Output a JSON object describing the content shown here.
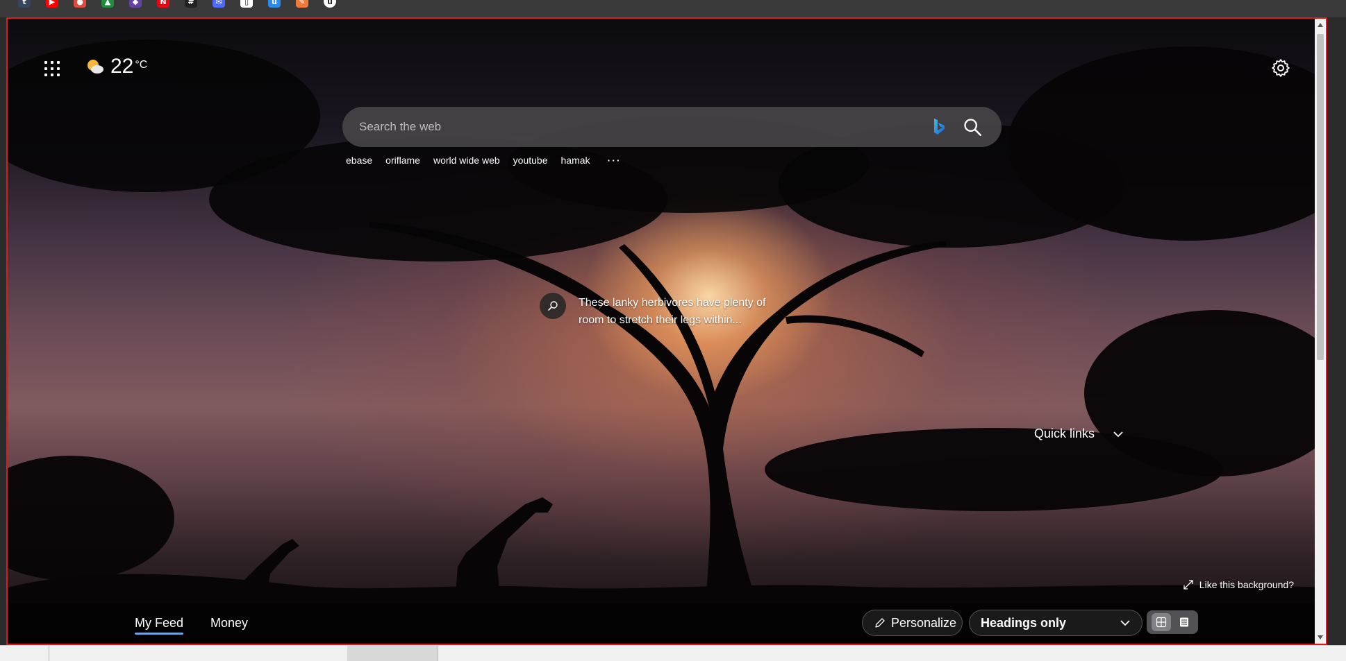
{
  "favorites": [
    {
      "name": "tumblr",
      "glyph": "t",
      "color": "#36465d"
    },
    {
      "name": "youtube",
      "glyph": "▶",
      "color": "#ff0000"
    },
    {
      "name": "pinterest",
      "glyph": "●",
      "color": "#e14a3c"
    },
    {
      "name": "google-drive",
      "glyph": "▲",
      "color": "#1e8e3e"
    },
    {
      "name": "twitch",
      "glyph": "◆",
      "color": "#6441a5"
    },
    {
      "name": "netflix",
      "glyph": "N",
      "color": "#e50914"
    },
    {
      "name": "grid",
      "glyph": "#",
      "color": "#222"
    },
    {
      "name": "messenger",
      "glyph": "✉",
      "color": "#4f6bff"
    },
    {
      "name": "document",
      "glyph": "▯",
      "color": "#ffffff"
    },
    {
      "name": "app-u",
      "glyph": "u",
      "color": "#2b8be6"
    },
    {
      "name": "app-pen",
      "glyph": "✎",
      "color": "#f07a3c"
    },
    {
      "name": "app-circle",
      "glyph": "u",
      "color": "#ffffff"
    }
  ],
  "weather": {
    "temp": "22",
    "unit": "°C"
  },
  "search": {
    "placeholder": "Search the web"
  },
  "suggestions": [
    "ebase",
    "oriflame",
    "world wide web",
    "youtube",
    "hamak"
  ],
  "suggestions_more": "···",
  "caption": {
    "text": "These lanky herbivores have plenty of room to stretch their legs within..."
  },
  "quick_links": {
    "label": "Quick links"
  },
  "like_background": {
    "label": "Like this background?"
  },
  "feed_tabs": {
    "my_feed": "My Feed",
    "money": "Money"
  },
  "personalize": {
    "label": "Personalize"
  },
  "layout_select": {
    "value": "Headings only"
  },
  "colors": {
    "accent": "#6aa6e6",
    "frame": "#e0181f"
  }
}
